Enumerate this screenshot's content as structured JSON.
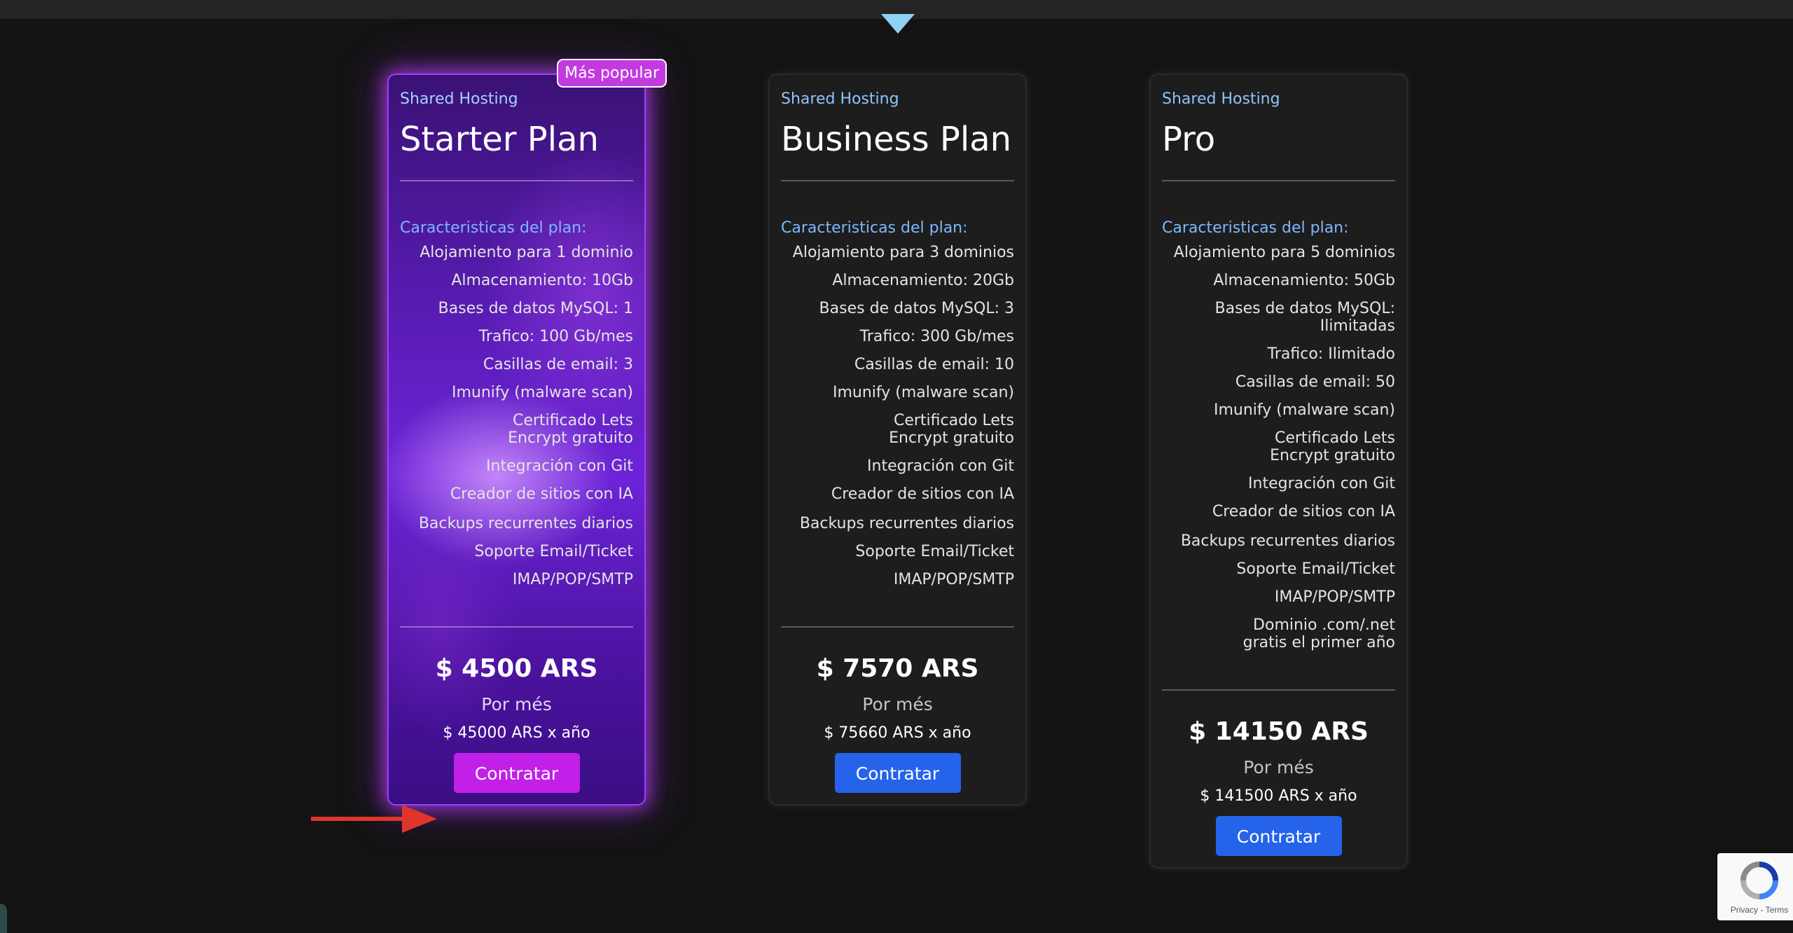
{
  "colors": {
    "background": "#131313",
    "card": "#1d1d1d",
    "accent_blue": "#2563eb",
    "category_blue": "#8ec4ff",
    "featured_purple": "#6d24d8",
    "featured_button": "#c21fe8",
    "badge": "#c33be0",
    "arrow": "#e0352b"
  },
  "icons": {
    "top_caret": "chevron-down-icon",
    "annotation_arrow": "arrow-right-icon",
    "recaptcha": "recaptcha-icon"
  },
  "plans": [
    {
      "badge": "Más popular",
      "category": "Shared Hosting",
      "title": "Starter Plan",
      "features_heading": "Caracteristicas del plan:",
      "features": [
        "Alojamiento para 1 dominio",
        "Almacenamiento: 10Gb",
        "Bases de datos MySQL: 1",
        "Trafico: 100 Gb/mes",
        "Casillas de email: 3",
        "Imunify (malware scan)",
        "Certificado Lets Encrypt gratuito",
        "Integración con Git",
        "Creador de sitios con IA",
        "Backups recurrentes diarios",
        "Soporte Email/Ticket",
        "IMAP/POP/SMTP"
      ],
      "price": "$ 4500 ARS",
      "period": "Por més",
      "yearly": "$ 45000 ARS x año",
      "button": "Contratar"
    },
    {
      "category": "Shared Hosting",
      "title": "Business Plan",
      "features_heading": "Caracteristicas del plan:",
      "features": [
        "Alojamiento para 3 dominios",
        "Almacenamiento: 20Gb",
        "Bases de datos MySQL: 3",
        "Trafico: 300 Gb/mes",
        "Casillas de email: 10",
        "Imunify (malware scan)",
        "Certificado Lets Encrypt gratuito",
        "Integración con Git",
        "Creador de sitios con IA",
        "Backups recurrentes diarios",
        "Soporte Email/Ticket",
        "IMAP/POP/SMTP"
      ],
      "price": "$ 7570 ARS",
      "period": "Por més",
      "yearly": "$ 75660 ARS x año",
      "button": "Contratar"
    },
    {
      "category": "Shared Hosting",
      "title": "Pro",
      "features_heading": "Caracteristicas del plan:",
      "features": [
        "Alojamiento para 5 dominios",
        "Almacenamiento: 50Gb",
        "Bases de datos MySQL: Ilimitadas",
        "Trafico: Ilimitado",
        "Casillas de email: 50",
        "Imunify (malware scan)",
        "Certificado Lets Encrypt gratuito",
        "Integración con Git",
        "Creador de sitios con IA",
        "Backups recurrentes diarios",
        "Soporte Email/Ticket",
        "IMAP/POP/SMTP",
        "Dominio .com/.net gratis el primer año"
      ],
      "price": "$ 14150 ARS",
      "period": "Por més",
      "yearly": "$ 141500 ARS x año",
      "button": "Contratar"
    }
  ],
  "recaptcha": {
    "privacy": "Privacy",
    "separator": "-",
    "terms": "Terms"
  }
}
